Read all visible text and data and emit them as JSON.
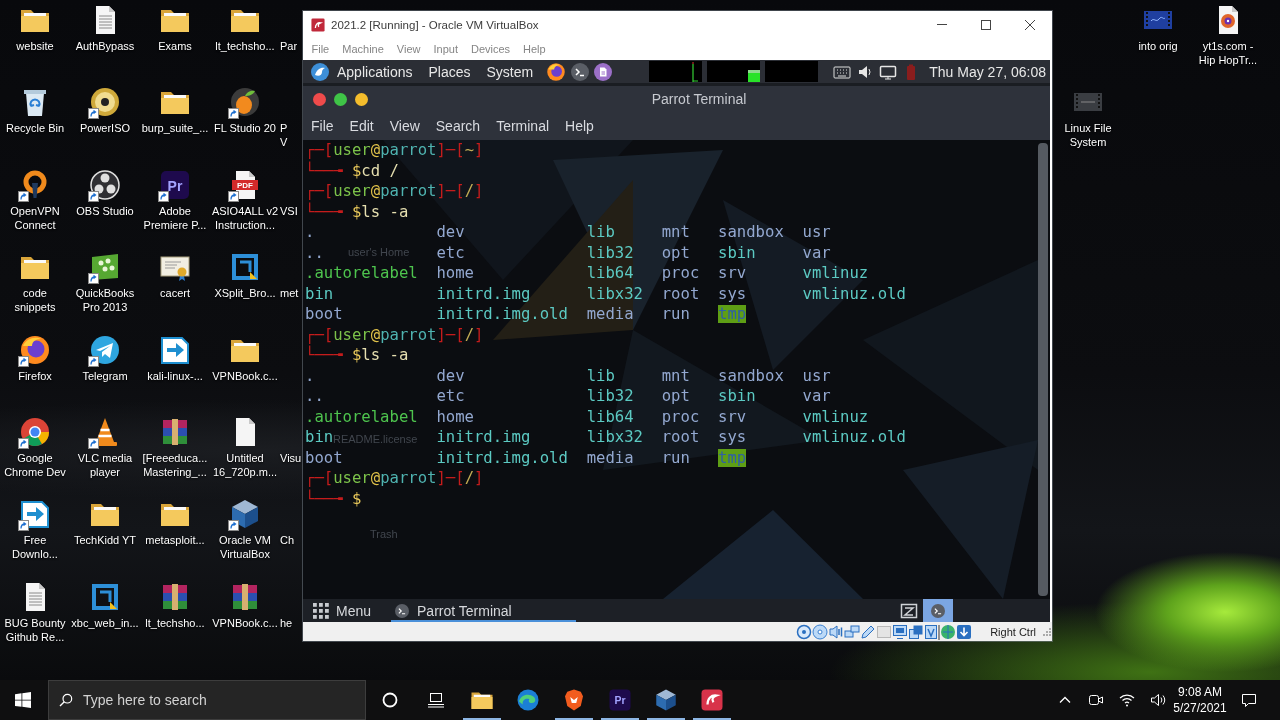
{
  "desktop": {
    "icons": [
      [
        {
          "label": "website",
          "kind": "folder",
          "shortcut": false
        },
        {
          "label": "AuthBypass",
          "kind": "document",
          "shortcut": false
        },
        {
          "label": "Exams",
          "kind": "folder",
          "shortcut": false
        },
        {
          "label": "lt_techsho...",
          "kind": "folder",
          "shortcut": false
        },
        {
          "label": "Par",
          "kind": "covered"
        }
      ],
      [
        {
          "label": "Recycle Bin",
          "kind": "recycle-bin",
          "shortcut": false
        },
        {
          "label": "PowerISO",
          "kind": "disc",
          "shortcut": true
        },
        {
          "label": "burp_suite_...",
          "kind": "folder",
          "shortcut": false
        },
        {
          "label": "FL Studio 20",
          "kind": "fruit",
          "shortcut": true
        },
        {
          "label": "P\nV",
          "kind": "covered"
        }
      ],
      [
        {
          "label": "OpenVPN\nConnect",
          "kind": "ring",
          "shortcut": true
        },
        {
          "label": "OBS Studio",
          "kind": "aperture",
          "shortcut": true
        },
        {
          "label": "Adobe\nPremiere P...",
          "kind": "letter-tile",
          "glyph": "Pr",
          "shortcut": true
        },
        {
          "label": "ASIO4ALL v2\nInstruction...",
          "kind": "pdf",
          "glyph": "PDF",
          "shortcut": true
        },
        {
          "label": "VSI",
          "kind": "covered"
        }
      ],
      [
        {
          "label": "code\nsnippets",
          "kind": "folder",
          "shortcut": false
        },
        {
          "label": "QuickBooks\nPro 2013",
          "kind": "dots-tile",
          "shortcut": true
        },
        {
          "label": "cacert",
          "kind": "certificate",
          "shortcut": false
        },
        {
          "label": "XSplit_Bro...",
          "kind": "square-frame",
          "shortcut": false
        },
        {
          "label": "met",
          "kind": "covered"
        }
      ],
      [
        {
          "label": "Firefox",
          "kind": "flame-globe",
          "shortcut": true
        },
        {
          "label": "Telegram",
          "kind": "paper-plane",
          "shortcut": true
        },
        {
          "label": "kali-linux-...",
          "kind": "arrow-page",
          "shortcut": false
        },
        {
          "label": "VPNBook.c...",
          "kind": "folder",
          "shortcut": false
        }
      ],
      [
        {
          "label": "Google\nChrome Dev",
          "kind": "tricolor",
          "shortcut": true
        },
        {
          "label": "VLC media\nplayer",
          "kind": "cone",
          "shortcut": true
        },
        {
          "label": "[Freeeduca...\nMastering_...",
          "kind": "archive",
          "shortcut": false
        },
        {
          "label": "Untitled\n16_720p.m...",
          "kind": "blank-file",
          "shortcut": false
        },
        {
          "label": "Visu",
          "kind": "covered"
        }
      ],
      [
        {
          "label": "Free\nDownlo...",
          "kind": "arrow-page",
          "shortcut": true
        },
        {
          "label": "TechKidd YT",
          "kind": "folder",
          "shortcut": false
        },
        {
          "label": "metasploit...",
          "kind": "folder",
          "shortcut": false
        },
        {
          "label": "Oracle VM\nVirtualBox",
          "kind": "cube",
          "shortcut": true
        },
        {
          "label": "Ch",
          "kind": "covered"
        }
      ],
      [
        {
          "label": "BUG Bounty\nGithub Re...",
          "kind": "document",
          "shortcut": false
        },
        {
          "label": "xbc_web_in...",
          "kind": "square-frame",
          "shortcut": false
        },
        {
          "label": "lt_techsho...",
          "kind": "archive",
          "shortcut": false
        },
        {
          "label": "VPNBook.c...",
          "kind": "archive",
          "shortcut": false
        },
        {
          "label": "he",
          "kind": "covered"
        }
      ]
    ],
    "right_icons": [
      {
        "label": "into orig",
        "kind": "video"
      },
      {
        "label": "yt1s.com -\nHip HopTr...",
        "kind": "audio-file"
      },
      {
        "label": "Linux File\nSystem",
        "kind": "video-dark"
      }
    ]
  },
  "virtualbox": {
    "title": "2021.2 [Running] - Oracle VM VirtualBox",
    "menu": [
      "File",
      "Machine",
      "View",
      "Input",
      "Devices",
      "Help"
    ],
    "parrot_panel": {
      "menus": [
        "Applications",
        "Places",
        "System"
      ],
      "clock": "Thu May 27, 06:08"
    },
    "terminal": {
      "title": "Parrot Terminal",
      "window_buttons": [
        {
          "color": "#ef4b4b"
        },
        {
          "color": "#3fc447"
        },
        {
          "color": "#f4bd2c"
        }
      ],
      "menu": [
        "File",
        "Edit",
        "View",
        "Search",
        "Terminal",
        "Help"
      ],
      "desktop_labels": [
        "user's Home",
        "README.license",
        "Trash"
      ],
      "lines": [
        {
          "kind": "prompt",
          "segments": [
            {
              "text": "┌─[",
              "kind": "frame"
            },
            {
              "text": "user",
              "kind": "user"
            },
            {
              "text": "@",
              "kind": "at"
            },
            {
              "text": "parrot",
              "kind": "host"
            },
            {
              "text": "]─[",
              "kind": "frame"
            },
            {
              "text": "~",
              "kind": "path"
            },
            {
              "text": "]",
              "kind": "frame"
            }
          ]
        },
        {
          "kind": "prompt",
          "segments": [
            {
              "text": "└──╼ ",
              "kind": "frame"
            },
            {
              "text": "$",
              "kind": "sign"
            },
            {
              "text": "cd /",
              "kind": "command"
            }
          ]
        },
        {
          "kind": "prompt",
          "segments": [
            {
              "text": "┌─[",
              "kind": "frame"
            },
            {
              "text": "user",
              "kind": "user"
            },
            {
              "text": "@",
              "kind": "at"
            },
            {
              "text": "parrot",
              "kind": "host"
            },
            {
              "text": "]─[",
              "kind": "frame"
            },
            {
              "text": "/",
              "kind": "path"
            },
            {
              "text": "]",
              "kind": "frame"
            }
          ]
        },
        {
          "kind": "prompt",
          "segments": [
            {
              "text": "└──╼ ",
              "kind": "frame"
            },
            {
              "text": "$",
              "kind": "sign"
            },
            {
              "text": "ls -a",
              "kind": "command"
            }
          ]
        },
        {
          "kind": "listing",
          "columns": [
            [
              {
                "name": ".",
                "kind": "dir"
              },
              {
                "name": "..",
                "kind": "dir"
              },
              {
                "name": ".autorelabel",
                "kind": "file"
              },
              {
                "name": "bin",
                "kind": "link"
              },
              {
                "name": "boot",
                "kind": "dir"
              }
            ],
            [
              {
                "name": "dev",
                "kind": "dir"
              },
              {
                "name": "etc",
                "kind": "dir"
              },
              {
                "name": "home",
                "kind": "dir"
              },
              {
                "name": "initrd.img",
                "kind": "link"
              },
              {
                "name": "initrd.img.old",
                "kind": "link"
              }
            ],
            [
              {
                "name": "lib",
                "kind": "link"
              },
              {
                "name": "lib32",
                "kind": "link"
              },
              {
                "name": "lib64",
                "kind": "link"
              },
              {
                "name": "libx32",
                "kind": "link"
              },
              {
                "name": "media",
                "kind": "dir"
              }
            ],
            [
              {
                "name": "mnt",
                "kind": "dir"
              },
              {
                "name": "opt",
                "kind": "dir"
              },
              {
                "name": "proc",
                "kind": "dir"
              },
              {
                "name": "root",
                "kind": "dir"
              },
              {
                "name": "run",
                "kind": "dir"
              }
            ],
            [
              {
                "name": "sandbox",
                "kind": "dir"
              },
              {
                "name": "sbin",
                "kind": "link"
              },
              {
                "name": "srv",
                "kind": "dir"
              },
              {
                "name": "sys",
                "kind": "dir"
              },
              {
                "name": "tmp",
                "kind": "sticky"
              }
            ],
            [
              {
                "name": "usr",
                "kind": "dir"
              },
              {
                "name": "var",
                "kind": "dir"
              },
              {
                "name": "vmlinuz",
                "kind": "link"
              },
              {
                "name": "vmlinuz.old",
                "kind": "link"
              }
            ]
          ]
        },
        {
          "kind": "prompt",
          "segments": [
            {
              "text": "┌─[",
              "kind": "frame"
            },
            {
              "text": "user",
              "kind": "user"
            },
            {
              "text": "@",
              "kind": "at"
            },
            {
              "text": "parrot",
              "kind": "host"
            },
            {
              "text": "]─[",
              "kind": "frame"
            },
            {
              "text": "/",
              "kind": "path"
            },
            {
              "text": "]",
              "kind": "frame"
            }
          ]
        },
        {
          "kind": "prompt",
          "segments": [
            {
              "text": "└──╼ ",
              "kind": "frame"
            },
            {
              "text": "$",
              "kind": "sign"
            },
            {
              "text": "ls -a",
              "kind": "command"
            }
          ]
        },
        {
          "kind": "listing",
          "columns": [
            [
              {
                "name": ".",
                "kind": "dir"
              },
              {
                "name": "..",
                "kind": "dir"
              },
              {
                "name": ".autorelabel",
                "kind": "file"
              },
              {
                "name": "bin",
                "kind": "link"
              },
              {
                "name": "boot",
                "kind": "dir"
              }
            ],
            [
              {
                "name": "dev",
                "kind": "dir"
              },
              {
                "name": "etc",
                "kind": "dir"
              },
              {
                "name": "home",
                "kind": "dir"
              },
              {
                "name": "initrd.img",
                "kind": "link"
              },
              {
                "name": "initrd.img.old",
                "kind": "link"
              }
            ],
            [
              {
                "name": "lib",
                "kind": "link"
              },
              {
                "name": "lib32",
                "kind": "link"
              },
              {
                "name": "lib64",
                "kind": "link"
              },
              {
                "name": "libx32",
                "kind": "link"
              },
              {
                "name": "media",
                "kind": "dir"
              }
            ],
            [
              {
                "name": "mnt",
                "kind": "dir"
              },
              {
                "name": "opt",
                "kind": "dir"
              },
              {
                "name": "proc",
                "kind": "dir"
              },
              {
                "name": "root",
                "kind": "dir"
              },
              {
                "name": "run",
                "kind": "dir"
              }
            ],
            [
              {
                "name": "sandbox",
                "kind": "dir"
              },
              {
                "name": "sbin",
                "kind": "link"
              },
              {
                "name": "srv",
                "kind": "dir"
              },
              {
                "name": "sys",
                "kind": "dir"
              },
              {
                "name": "tmp",
                "kind": "sticky"
              }
            ],
            [
              {
                "name": "usr",
                "kind": "dir"
              },
              {
                "name": "var",
                "kind": "dir"
              },
              {
                "name": "vmlinuz",
                "kind": "link"
              },
              {
                "name": "vmlinuz.old",
                "kind": "link"
              }
            ]
          ]
        },
        {
          "kind": "prompt",
          "segments": [
            {
              "text": "┌─[",
              "kind": "frame"
            },
            {
              "text": "user",
              "kind": "user"
            },
            {
              "text": "@",
              "kind": "at"
            },
            {
              "text": "parrot",
              "kind": "host"
            },
            {
              "text": "]─[",
              "kind": "frame"
            },
            {
              "text": "/",
              "kind": "path"
            },
            {
              "text": "]",
              "kind": "frame"
            }
          ]
        },
        {
          "kind": "prompt",
          "segments": [
            {
              "text": "└──╼ ",
              "kind": "frame"
            },
            {
              "text": "$",
              "kind": "sign"
            }
          ]
        }
      ]
    },
    "bottom_panel": {
      "menu_label": "Menu",
      "tasks": [
        {
          "label": "Parrot Terminal",
          "selected": true
        }
      ],
      "workspaces": [
        {
          "selected": true
        }
      ]
    },
    "status_bar": {
      "host_key": "Right Ctrl"
    }
  },
  "taskbar": {
    "search": {
      "placeholder": "Type here to search"
    },
    "apps": [
      {
        "kind": "folder",
        "running": true
      },
      {
        "kind": "wave-circle",
        "running": false
      },
      {
        "kind": "lion-shield",
        "running": true
      },
      {
        "kind": "letter-tile",
        "glyph": "Pr",
        "running": true
      },
      {
        "kind": "cube",
        "running": true
      },
      {
        "kind": "swirl-tile",
        "running": true
      }
    ],
    "time": "9:08 AM",
    "date": "5/27/2021"
  }
}
